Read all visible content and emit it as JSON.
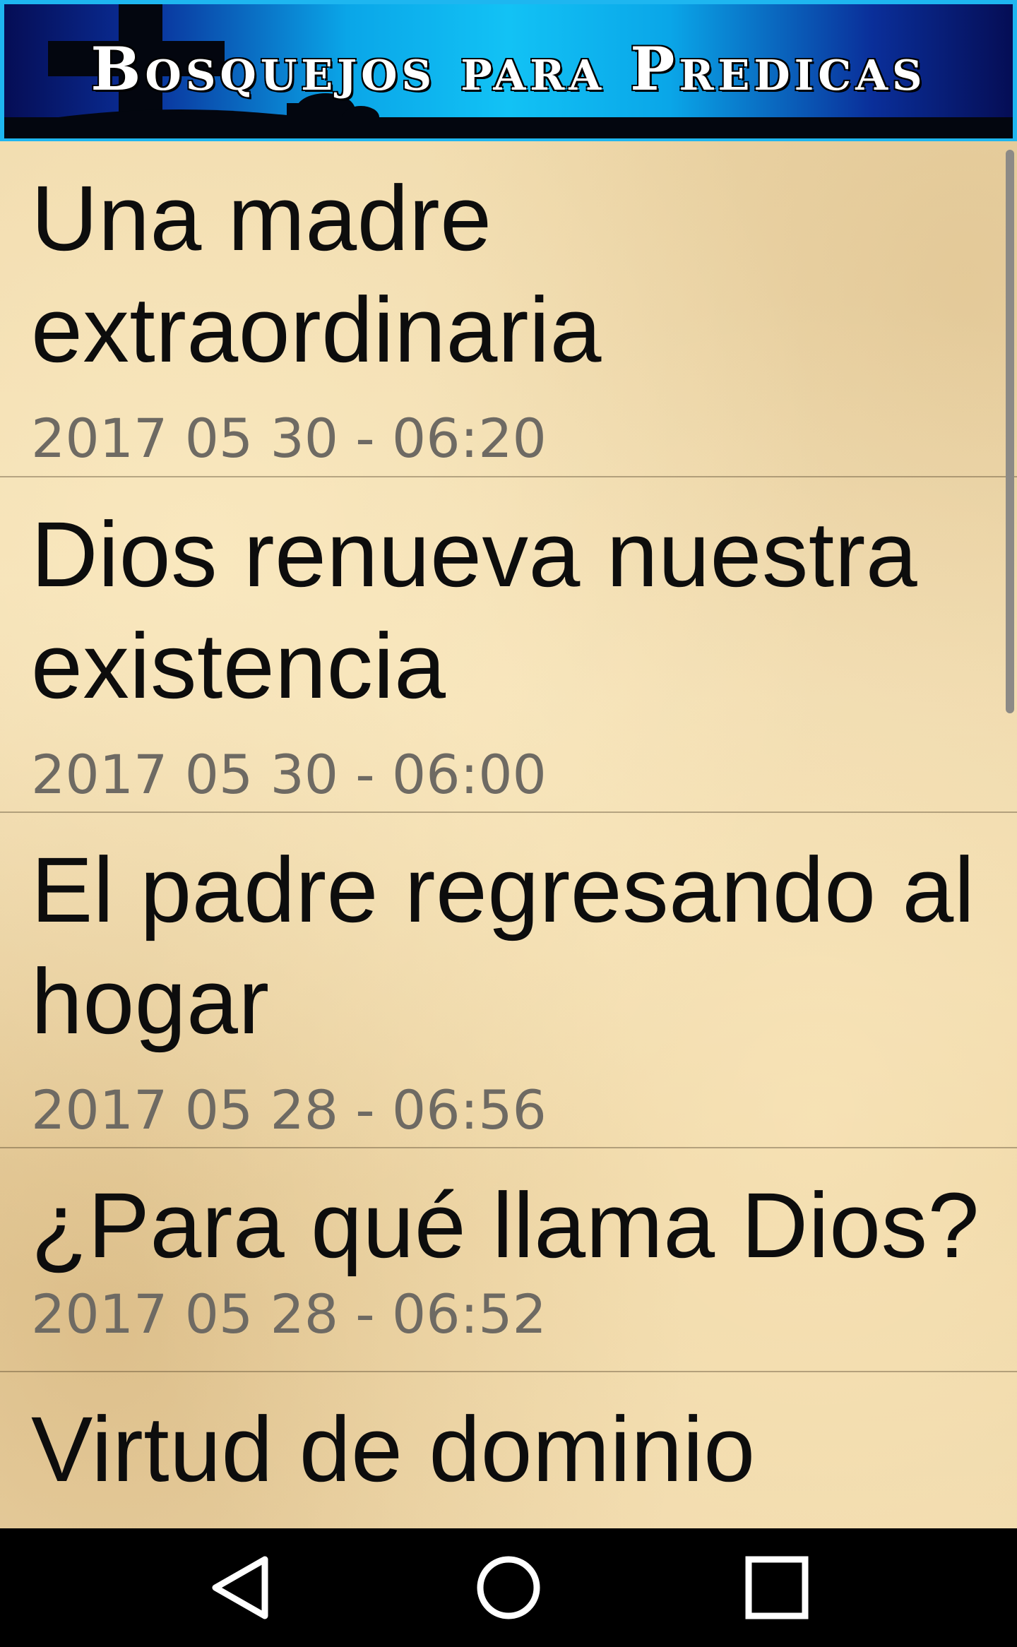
{
  "header": {
    "title": "Bosquejos para Predicas"
  },
  "sermons": [
    {
      "title": "Una madre extraordinaria",
      "date": "2017 05 30 - 06:20"
    },
    {
      "title": "Dios renueva nuestra existencia",
      "date": "2017 05 30 - 06:00"
    },
    {
      "title": "El padre regresando al hogar",
      "date": "2017 05 28 - 06:56"
    },
    {
      "title": "¿Para qué llama Dios?",
      "date": "2017 05 28 - 06:52"
    },
    {
      "title": "Virtud de dominio",
      "date": ""
    }
  ],
  "navbar": {
    "back_icon": "back-triangle-icon",
    "home_icon": "home-circle-icon",
    "recents_icon": "recents-square-icon"
  },
  "colors": {
    "header_border": "#1eb6f0",
    "header_sky_center": "#12c2f5",
    "header_sky_edge": "#050d55",
    "parchment": "#efd9ab",
    "title_text": "#0d0d0d",
    "date_text": "#6e6a63",
    "navbar_bg": "#000000"
  }
}
